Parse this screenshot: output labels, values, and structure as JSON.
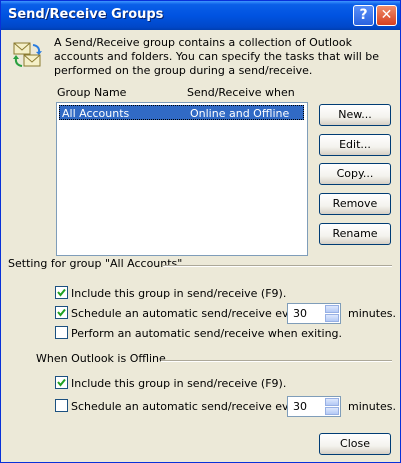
{
  "window": {
    "title": "Send/Receive Groups"
  },
  "description": "A Send/Receive group contains a collection of Outlook accounts and folders. You can specify the tasks that will be performed on the group during a send/receive.",
  "list": {
    "col1": "Group Name",
    "col2": "Send/Receive when",
    "rows": [
      {
        "name": "All Accounts",
        "when": "Online and Offline",
        "selected": true
      }
    ]
  },
  "buttons": {
    "new": "New...",
    "edit": "Edit...",
    "copy": "Copy...",
    "remove": "Remove",
    "rename": "Rename",
    "close": "Close"
  },
  "setting": {
    "label": "Setting for group \"All Accounts\"",
    "include": {
      "label": "Include this group in send/receive (F9).",
      "checked": true
    },
    "schedule": {
      "label": "Schedule an automatic send/receive every",
      "checked": true,
      "value": "30",
      "unit": "minutes."
    },
    "exit": {
      "label": "Perform an automatic send/receive when exiting.",
      "checked": false
    }
  },
  "offline": {
    "label": "When Outlook is Offline",
    "include": {
      "label": "Include this group in send/receive (F9).",
      "checked": true
    },
    "schedule": {
      "label": "Schedule an automatic send/receive every",
      "checked": false,
      "value": "30",
      "unit": "minutes."
    }
  },
  "icons": {
    "main": "send-receive-icon",
    "help": "help-icon",
    "close": "close-icon"
  }
}
